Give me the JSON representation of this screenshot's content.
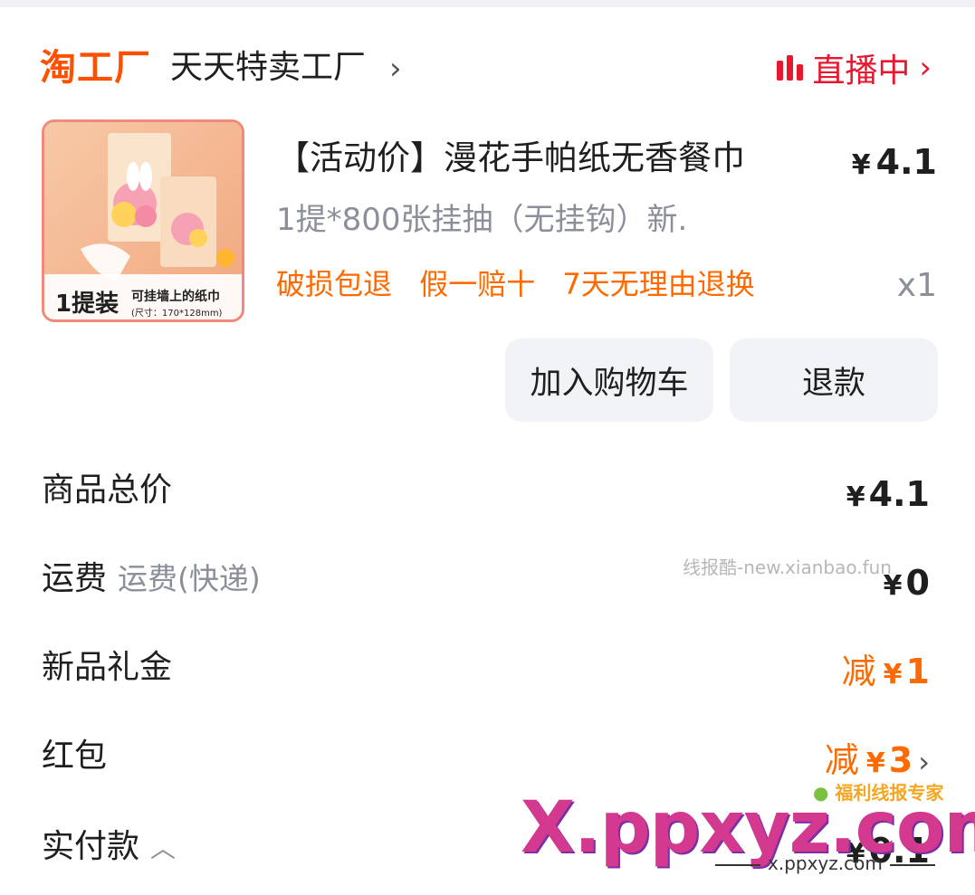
{
  "shop": {
    "logo": "淘工厂",
    "name": "天天特卖工厂",
    "chevron": "›",
    "live_label": "直播中",
    "live_chevron": "›",
    "colors": {
      "logo": "#ff5000",
      "live": "#e8172d"
    }
  },
  "product": {
    "title": "【活动价】漫花手帕纸无香餐巾",
    "price_symbol": "¥",
    "price": "4.1",
    "spec": "1提*800张挂抽（无挂钩）新.",
    "tags": [
      "破损包退",
      "假一赔十",
      "7天无理由退换"
    ],
    "quantity": "x1",
    "image": {
      "icon": "product-image",
      "badge_main": "1提装",
      "badge_text": "可挂墙上的纸巾",
      "badge_size": "(尺寸：170*128mm)"
    }
  },
  "actions": {
    "add_to_cart": "加入购物车",
    "refund": "退款"
  },
  "summary": {
    "total": {
      "label": "商品总价",
      "symbol": "¥",
      "value": "4.1"
    },
    "shipping": {
      "label": "运费",
      "sub": "运费(快递)",
      "symbol": "¥",
      "value": "0"
    },
    "gift": {
      "label": "新品礼金",
      "prefix": "减",
      "symbol": "¥",
      "value": "1"
    },
    "redpacket": {
      "label": "红包",
      "prefix": "减",
      "symbol": "¥",
      "value": "3",
      "chevron": "›"
    },
    "paid": {
      "label": "实付款",
      "chevron": "︿",
      "symbol": "¥",
      "value": "0.1"
    }
  },
  "watermarks": {
    "xianbao": "线报酷-new.xianbao.fun",
    "fuli": "福利线报专家",
    "big": "X.ppxyz.com",
    "small": "x.ppxyz.com"
  },
  "colors": {
    "accent_orange": "#ff6a00",
    "muted": "#8a8f99",
    "button_bg": "#f1f3f6"
  }
}
